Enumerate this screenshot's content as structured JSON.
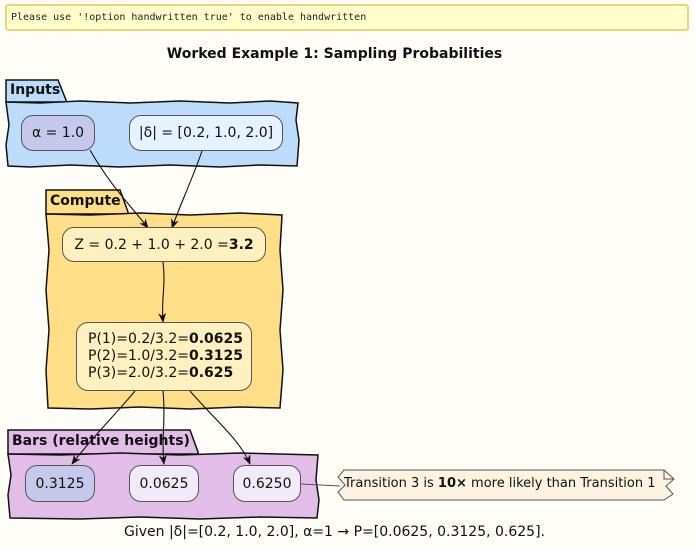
{
  "banner": "Please use '!option handwritten true' to enable handwritten",
  "title": "Worked Example 1: Sampling Probabilities",
  "packages": {
    "inputs": "Inputs",
    "compute": "Compute",
    "bars": "Bars (relative heights)"
  },
  "nodes": {
    "alpha": "α = 1.0",
    "delta": "|δ| = [0.2, 1.0, 2.0]",
    "z_prefix": "Z = 0.2 + 1.0 + 2.0 = ",
    "z_value": "3.2",
    "p1_prefix": "P(1)=0.2/3.2=",
    "p1_value": "0.0625",
    "p2_prefix": "P(2)=1.0/3.2=",
    "p2_value": "0.3125",
    "p3_prefix": "P(3)=2.0/3.2=",
    "p3_value": "0.625",
    "bar1": "0.3125",
    "bar2": "0.0625",
    "bar3": "0.6250"
  },
  "note": {
    "prefix": "Transition 3 is ",
    "emphasis": "10×",
    "suffix": " more likely than Transition 1"
  },
  "caption": "Given |δ|=[0.2, 1.0, 2.0], α=1 → P=[0.0625, 0.3125, 0.625].",
  "colors": {
    "inputs_bg": "#bddcfb",
    "compute_bg": "#ffde88",
    "bars_bg": "#e2bde8",
    "alpha_node": "#c5c8ea",
    "delta_node": "#e6f2fd",
    "z_node": "#fff0c0",
    "p_node": "#fff0c0",
    "bar1_node": "#c5c8ea",
    "bar_node": "#f1eaf8",
    "note_bg": "#fdf3e2"
  }
}
